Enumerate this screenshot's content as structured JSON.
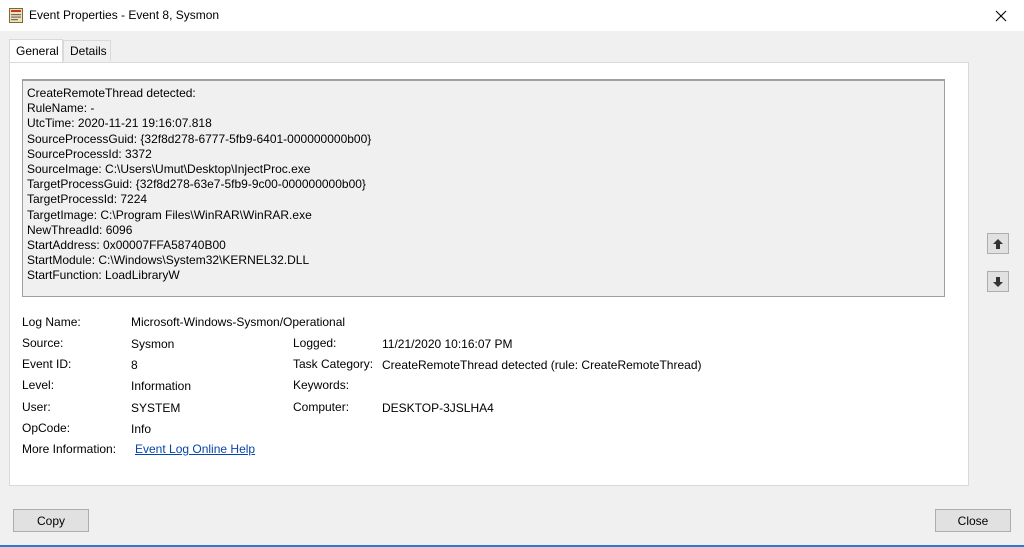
{
  "window": {
    "title": "Event Properties - Event 8, Sysmon"
  },
  "tabs": [
    {
      "label": "General",
      "active": true
    },
    {
      "label": "Details",
      "active": false
    }
  ],
  "description_lines": [
    "CreateRemoteThread detected:",
    "RuleName: -",
    "UtcTime: 2020-11-21 19:16:07.818",
    "SourceProcessGuid: {32f8d278-6777-5fb9-6401-000000000b00}",
    "SourceProcessId: 3372",
    "SourceImage: C:\\Users\\Umut\\Desktop\\InjectProc.exe",
    "TargetProcessGuid: {32f8d278-63e7-5fb9-9c00-000000000b00}",
    "TargetProcessId: 7224",
    "TargetImage: C:\\Program Files\\WinRAR\\WinRAR.exe",
    "NewThreadId: 6096",
    "StartAddress: 0x00007FFA58740B00",
    "StartModule: C:\\Windows\\System32\\KERNEL32.DLL",
    "StartFunction: LoadLibraryW"
  ],
  "fields": {
    "log_name": {
      "label": "Log Name:",
      "value": "Microsoft-Windows-Sysmon/Operational"
    },
    "source": {
      "label": "Source:",
      "value": "Sysmon"
    },
    "logged": {
      "label": "Logged:",
      "value": "11/21/2020 10:16:07 PM"
    },
    "event_id": {
      "label": "Event ID:",
      "value": "8"
    },
    "task_category": {
      "label": "Task Category:",
      "value": "CreateRemoteThread detected (rule: CreateRemoteThread)"
    },
    "level": {
      "label": "Level:",
      "value": "Information"
    },
    "keywords": {
      "label": "Keywords:",
      "value": ""
    },
    "user": {
      "label": "User:",
      "value": "SYSTEM"
    },
    "computer": {
      "label": "Computer:",
      "value": "DESKTOP-3JSLHA4"
    },
    "opcode": {
      "label": "OpCode:",
      "value": "Info"
    },
    "more_info": {
      "label": "More Information:",
      "link": "Event Log Online Help"
    }
  },
  "buttons": {
    "copy": "Copy",
    "close": "Close"
  },
  "icons": {
    "app": "event-viewer-icon",
    "close": "close-icon",
    "up": "arrow-up-icon",
    "down": "arrow-down-icon"
  },
  "colors": {
    "link": "#0645ad",
    "accent": "#2b7bd1"
  }
}
